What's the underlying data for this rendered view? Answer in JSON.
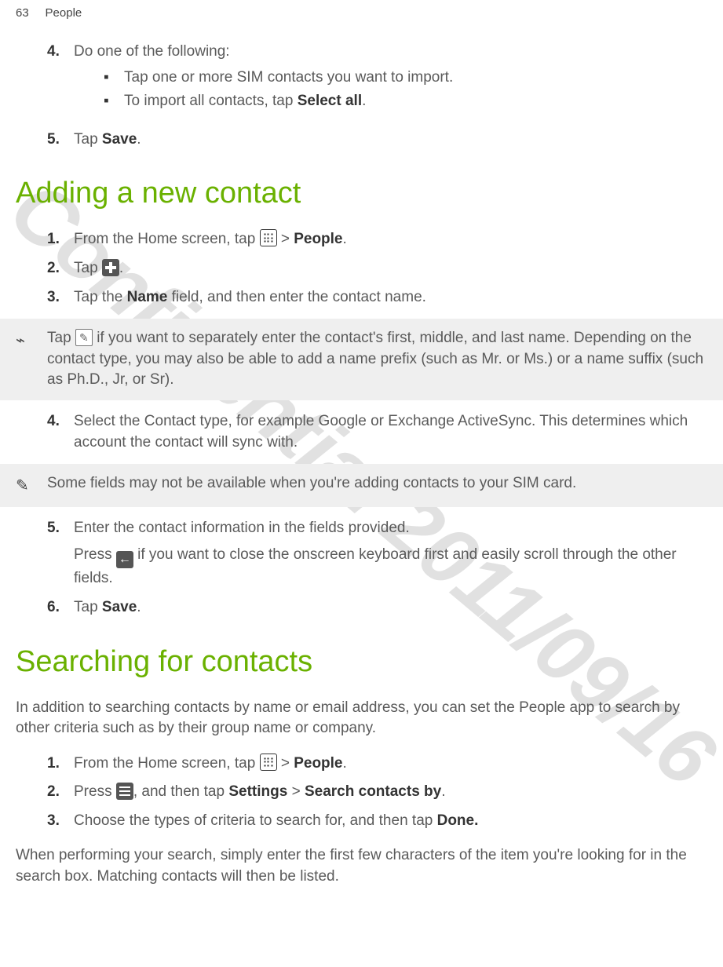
{
  "header": {
    "page_number": "63",
    "section": "People"
  },
  "watermark": "Confidential  2011/09/16",
  "continuation": {
    "step4": {
      "num": "4.",
      "text": "Do one of the following:",
      "bullets": [
        "Tap one or more SIM contacts you want to import.",
        {
          "pre": "To import all contacts, tap ",
          "bold": "Select all",
          "post": "."
        }
      ]
    },
    "step5": {
      "num": "5.",
      "pre": "Tap ",
      "bold": "Save",
      "post": "."
    }
  },
  "adding": {
    "heading": "Adding a new contact",
    "steps": {
      "s1": {
        "num": "1.",
        "pre": "From the Home screen, tap ",
        "post_icon": " > ",
        "bold": "People",
        "post": "."
      },
      "s2": {
        "num": "2.",
        "pre": "Tap ",
        "post": "."
      },
      "s3": {
        "num": "3.",
        "pre": "Tap the ",
        "bold": "Name",
        "mid": " field, and then enter the contact name."
      },
      "tip1": {
        "pre": "Tap ",
        "post": " if you want to separately enter the contact's first, middle, and last name. Depending on the contact type, you may also be able to add a name prefix (such as Mr. or Ms.) or a name suffix (such as Ph.D., Jr, or Sr)."
      },
      "s4": {
        "num": "4.",
        "text": "Select the Contact type, for example Google or Exchange ActiveSync. This determines which account the contact will sync with."
      },
      "tip2": "Some fields may not be available when you're adding contacts to your SIM card.",
      "s5": {
        "num": "5.",
        "text": "Enter the contact information in the fields provided.",
        "sub_pre": "Press ",
        "sub_post": " if you want to close the onscreen keyboard first and easily scroll through the other fields."
      },
      "s6": {
        "num": "6.",
        "pre": "Tap ",
        "bold": "Save",
        "post": "."
      }
    }
  },
  "searching": {
    "heading": "Searching for contacts",
    "intro": "In addition to searching contacts by name or email address, you can set the People app to search by other criteria such as by their group name or company.",
    "steps": {
      "s1": {
        "num": "1.",
        "pre": "From the Home screen, tap ",
        "post_icon": " > ",
        "bold": "People",
        "post": "."
      },
      "s2": {
        "num": "2.",
        "pre": "Press ",
        "mid": ", and then tap ",
        "bold1": "Settings",
        "sep": " > ",
        "bold2": "Search contacts by",
        "post": "."
      },
      "s3": {
        "num": "3.",
        "pre": "Choose the types of criteria to search for, and then tap ",
        "bold": "Done.",
        "post": ""
      }
    },
    "outro": "When performing your search, simply enter the first few characters of the item you're looking for in the search box. Matching contacts will then be listed."
  }
}
